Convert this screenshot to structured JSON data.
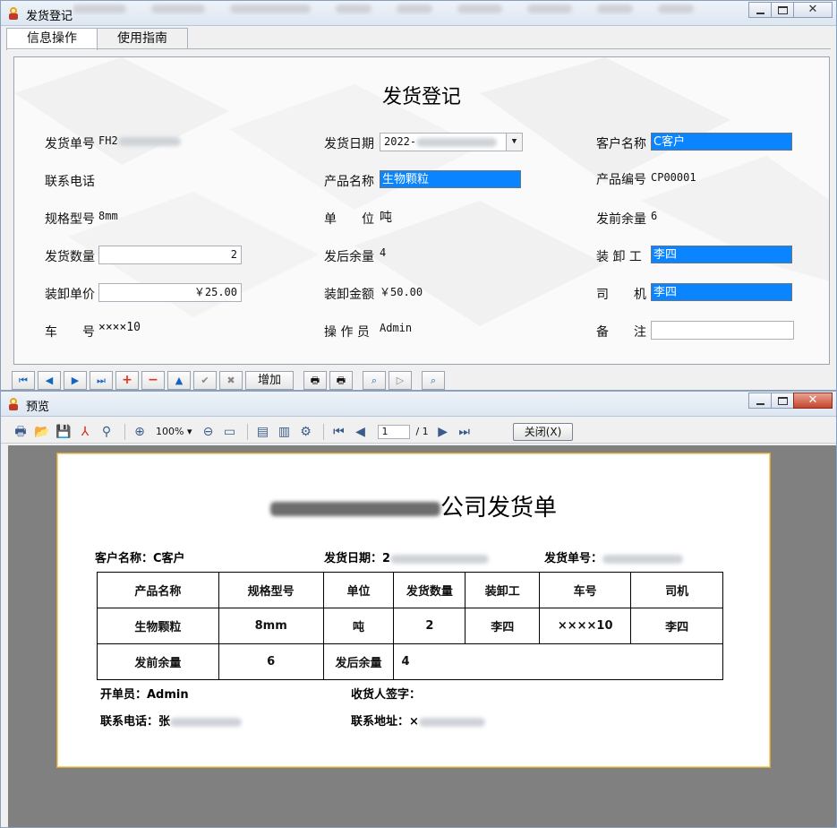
{
  "main_window": {
    "title": "发货登记",
    "tabs": [
      {
        "label": "信息操作",
        "active": true
      },
      {
        "label": "使用指南",
        "active": false
      }
    ],
    "form": {
      "title": "发货登记",
      "ship_no_label": "发货单号",
      "ship_no_value": "FH2",
      "ship_date_label": "发货日期",
      "ship_date_value": "2022-",
      "customer_label": "客户名称",
      "customer_value": "C客户",
      "phone_label": "联系电话",
      "product_name_label": "产品名称",
      "product_name_value": "生物颗粒",
      "product_code_label": "产品编号",
      "product_code_value": "CP00001",
      "spec_label": "规格型号",
      "spec_value": "8mm",
      "unit_label": "单　　位",
      "unit_value": "吨",
      "before_qty_label": "发前余量",
      "before_qty_value": "6",
      "ship_qty_label": "发货数量",
      "ship_qty_value": "2",
      "after_qty_label": "发后余量",
      "after_qty_value": "4",
      "loader_label": "装 卸 工",
      "loader_value": "李四",
      "unit_price_label": "装卸单价",
      "unit_price_value": "￥25.00",
      "amount_label": "装卸金额",
      "amount_value": "￥50.00",
      "driver_label": "司　　机",
      "driver_value": "李四",
      "car_label": "车　　号",
      "car_value": "××××10",
      "operator_label": "操 作 员",
      "operator_value": "Admin",
      "remark_label": "备　　注",
      "remark_value": ""
    },
    "navbar": {
      "add_label": "增加"
    }
  },
  "preview_window": {
    "title": "预览",
    "zoom": "100%",
    "page_current": "1",
    "page_total": "/ 1",
    "close_label": "关闭(X)",
    "document": {
      "title_suffix": "公司发货单",
      "customer": "客户名称：C客户",
      "date_label": "发货日期：2",
      "ship_no_label": "发货单号：",
      "table_headers": [
        "产品名称",
        "规格型号",
        "单位",
        "发货数量",
        "装卸工",
        "车号",
        "司机"
      ],
      "table_row": [
        "生物颗粒",
        "8mm",
        "吨",
        "2",
        "李四",
        "××××10",
        "李四"
      ],
      "before_label": "发前余量",
      "before_value": "6",
      "after_label": "发后余量",
      "after_value": "4",
      "issuer": "开单员：Admin",
      "receiver_sign": "收货人签字：",
      "contact_phone": "联系电话：张",
      "contact_addr": "联系地址：×"
    }
  },
  "colors": {
    "selection": "#0a84ff",
    "preview_canvas": "#808080",
    "paper_border": "#d8a63a"
  }
}
